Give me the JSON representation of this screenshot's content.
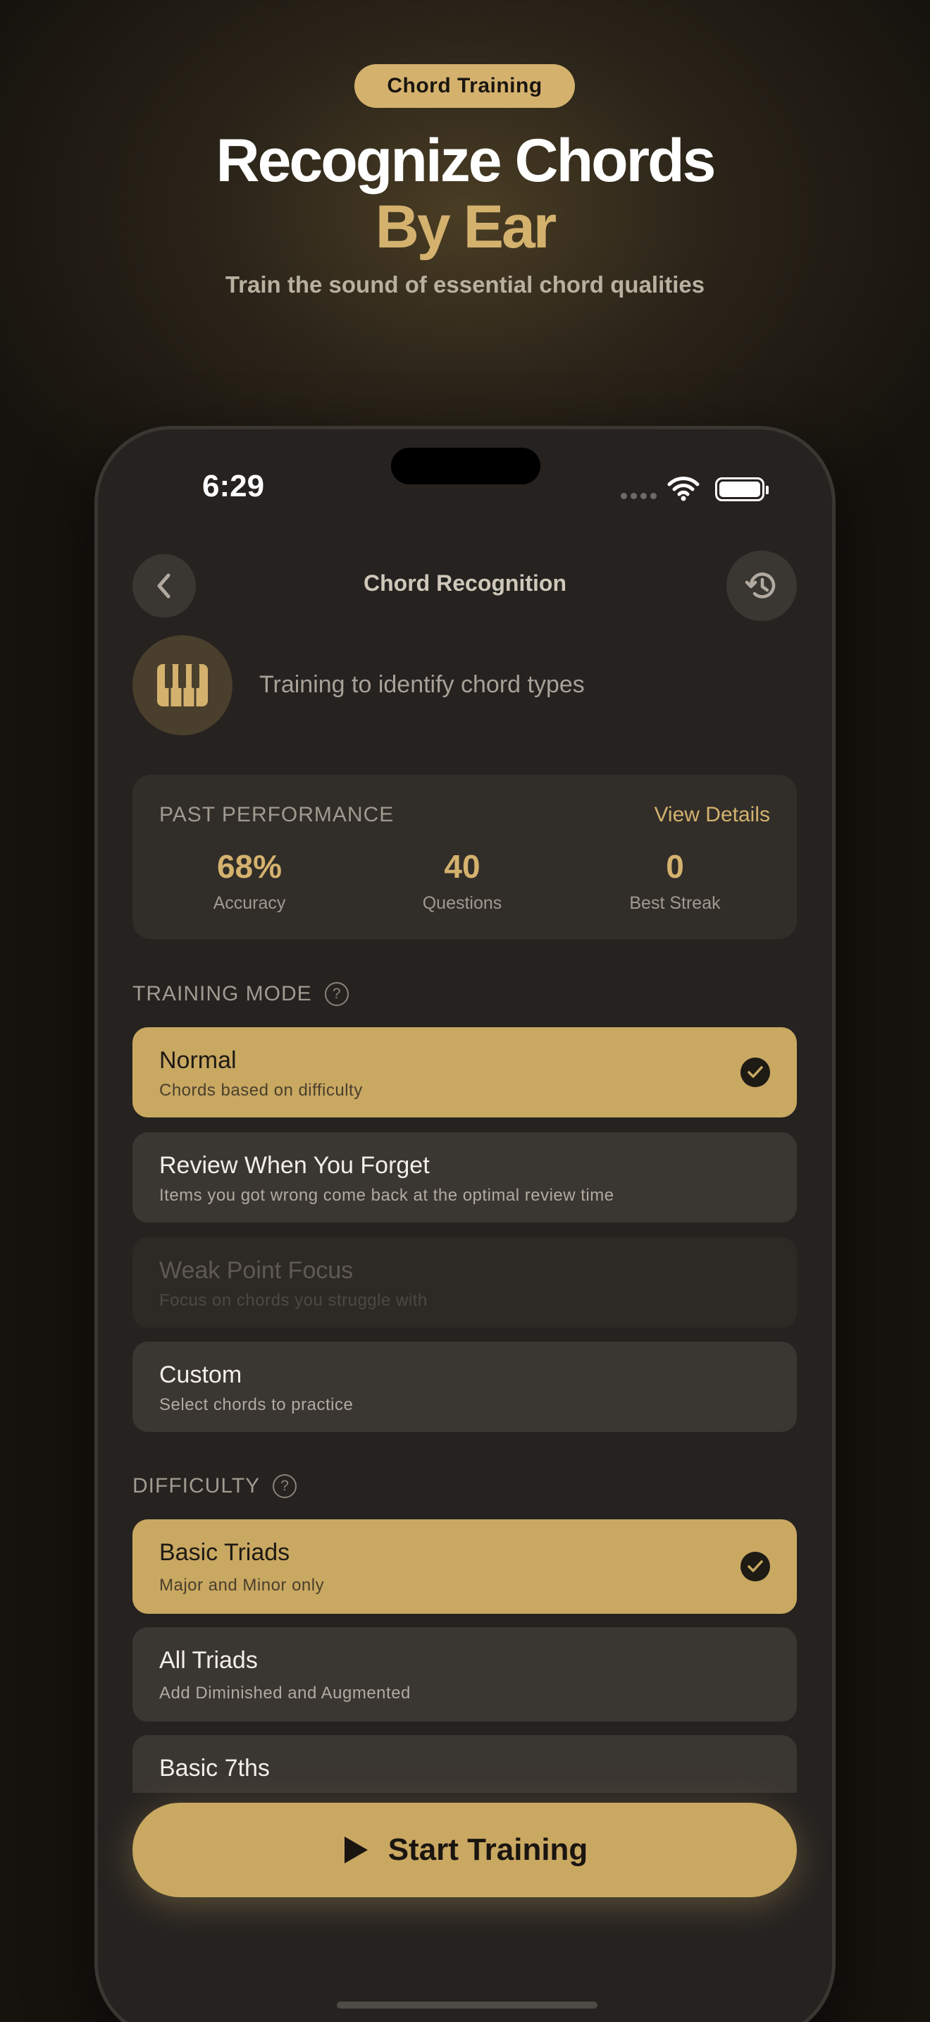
{
  "hero": {
    "badge": "Chord Training",
    "headline_line1": "Recognize Chords",
    "headline_line2": "By Ear",
    "subheadline": "Train the sound of essential chord qualities"
  },
  "status_bar": {
    "time": "6:29"
  },
  "nav": {
    "title": "Chord Recognition",
    "back_icon": "chevron-left-icon",
    "history_icon": "history-clock-icon"
  },
  "intro": {
    "icon": "piano-keys-icon",
    "text": "Training to identify chord types"
  },
  "performance": {
    "label": "PAST PERFORMANCE",
    "link": "View Details",
    "stats": [
      {
        "value": "68%",
        "label": "Accuracy"
      },
      {
        "value": "40",
        "label": "Questions"
      },
      {
        "value": "0",
        "label": "Best Streak"
      }
    ]
  },
  "training_mode": {
    "label": "TRAINING MODE",
    "help": "?",
    "options": [
      {
        "title": "Normal",
        "subtitle": "Chords based on difficulty",
        "state": "selected"
      },
      {
        "title": "Review When You Forget",
        "subtitle": "Items you got wrong come back at the optimal review time",
        "state": "default"
      },
      {
        "title": "Weak Point Focus",
        "subtitle": "Focus on chords you struggle with",
        "state": "disabled"
      },
      {
        "title": "Custom",
        "subtitle": "Select chords to practice",
        "state": "default"
      }
    ]
  },
  "difficulty": {
    "label": "DIFFICULTY",
    "help": "?",
    "options": [
      {
        "title": "Basic Triads",
        "subtitle": "Major and Minor only",
        "state": "selected"
      },
      {
        "title": "All Triads",
        "subtitle": "Add Diminished and Augmented",
        "state": "default"
      },
      {
        "title": "Basic 7ths",
        "subtitle": "",
        "state": "default"
      }
    ]
  },
  "cta": {
    "label": "Start Training",
    "icon": "play-icon"
  },
  "colors": {
    "accent": "#c9a862",
    "badge": "#d4b26e",
    "background": "#252220",
    "card": "#3a3632"
  }
}
